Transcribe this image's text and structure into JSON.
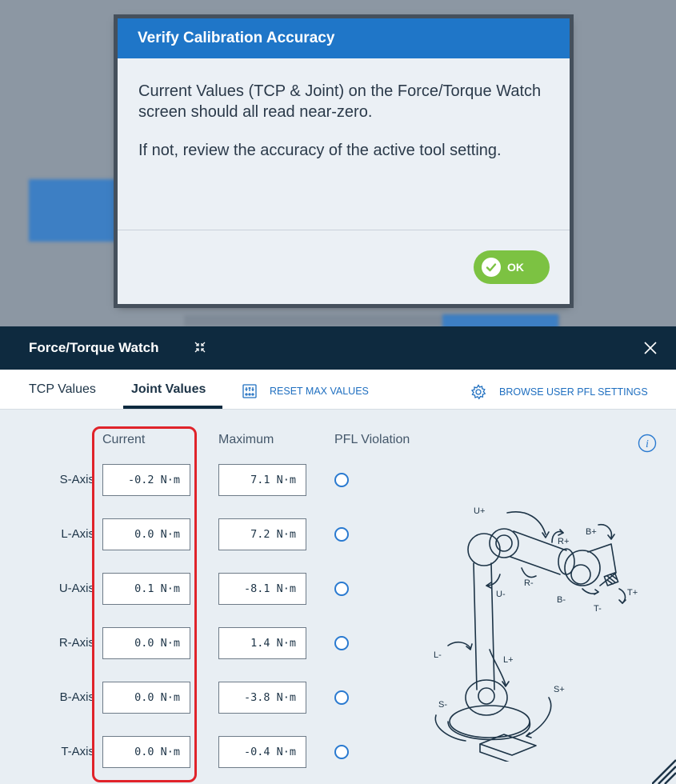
{
  "dialog": {
    "title": "Verify Calibration Accuracy",
    "paragraph1": "Current Values (TCP & Joint) on the Force/Torque Watch screen should all read near-zero.",
    "paragraph2": "If not, review the accuracy of the active tool setting.",
    "ok_label": "OK"
  },
  "panel": {
    "title": "Force/Torque Watch",
    "tabs": [
      "TCP Values",
      "Joint Values"
    ],
    "active_tab": "Joint Values",
    "reset_label": "RESET MAX VALUES",
    "browse_label": "BROWSE USER PFL SETTINGS"
  },
  "columns": {
    "current": "Current",
    "maximum": "Maximum",
    "pfl": "PFL Violation"
  },
  "rows": [
    {
      "axis": "S-Axis",
      "current": "-0.2 N·m",
      "maximum": "7.1 N·m"
    },
    {
      "axis": "L-Axis",
      "current": "0.0 N·m",
      "maximum": "7.2 N·m"
    },
    {
      "axis": "U-Axis",
      "current": "0.1 N·m",
      "maximum": "-8.1 N·m"
    },
    {
      "axis": "R-Axis",
      "current": "0.0 N·m",
      "maximum": "1.4 N·m"
    },
    {
      "axis": "B-Axis",
      "current": "0.0 N·m",
      "maximum": "-3.8 N·m"
    },
    {
      "axis": "T-Axis",
      "current": "0.0 N·m",
      "maximum": "-0.4 N·m"
    }
  ],
  "robot_labels": {
    "u_plus": "U+",
    "u_minus": "U-",
    "r_plus": "R+",
    "r_minus": "R-",
    "b_plus": "B+",
    "b_minus": "B-",
    "t_plus": "T+",
    "t_minus": "T-",
    "l_plus": "L+",
    "l_minus": "L-",
    "s_plus": "S+",
    "s_minus": "S-"
  },
  "colors": {
    "accent": "#1f76c8",
    "header": "#0e2a3f",
    "ok": "#7cc242",
    "highlight": "#e0232a"
  },
  "icons": [
    "collapse-icon",
    "close-icon",
    "reset-icon",
    "gear-icon",
    "info-icon",
    "check-icon",
    "resize-icon"
  ]
}
